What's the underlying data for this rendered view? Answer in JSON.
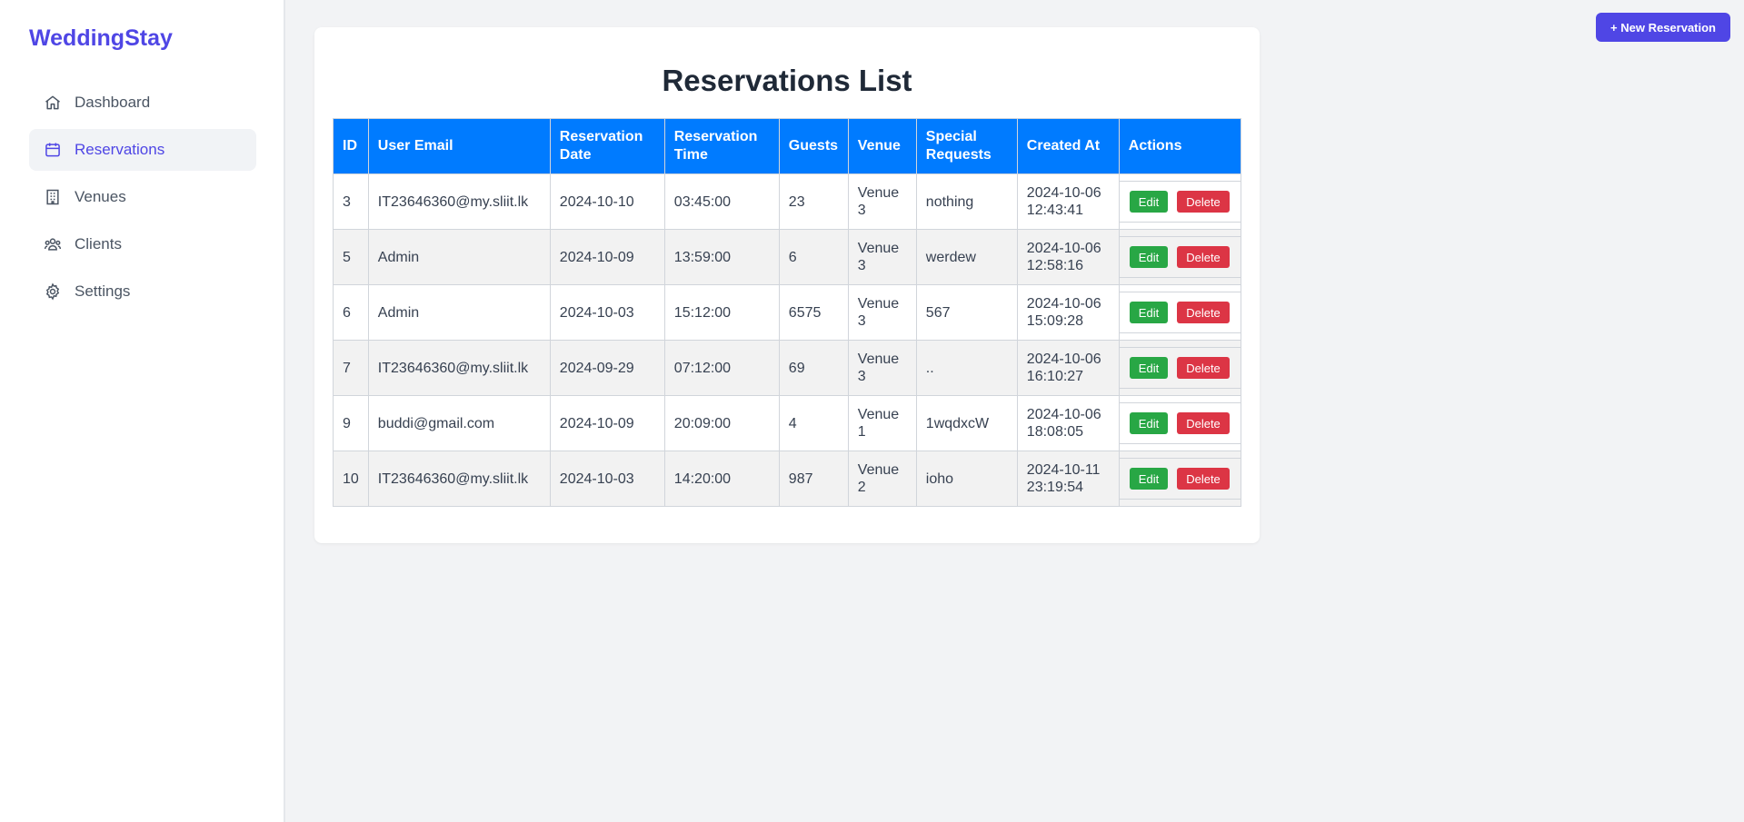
{
  "app": {
    "brand": "WeddingStay"
  },
  "colors": {
    "accent": "#4f46e5",
    "table_header": "#007bff",
    "edit": "#28a745",
    "delete": "#dc3545"
  },
  "sidebar": {
    "items": [
      {
        "label": "Dashboard",
        "icon": "home-icon",
        "active": false
      },
      {
        "label": "Reservations",
        "icon": "calendar-icon",
        "active": true
      },
      {
        "label": "Venues",
        "icon": "building-icon",
        "active": false
      },
      {
        "label": "Clients",
        "icon": "users-icon",
        "active": false
      },
      {
        "label": "Settings",
        "icon": "gear-icon",
        "active": false
      }
    ]
  },
  "header": {
    "new_button": "+ New Reservation"
  },
  "main": {
    "title": "Reservations List",
    "columns": [
      "ID",
      "User Email",
      "Reservation Date",
      "Reservation Time",
      "Guests",
      "Venue",
      "Special Requests",
      "Created At",
      "Actions"
    ],
    "rows": [
      {
        "id": "3",
        "email": "IT23646360@my.sliit.lk",
        "date": "2024-10-10",
        "time": "03:45:00",
        "guests": "23",
        "venue": "Venue 3",
        "requests": "nothing",
        "created": "2024-10-06 12:43:41"
      },
      {
        "id": "5",
        "email": "Admin",
        "date": "2024-10-09",
        "time": "13:59:00",
        "guests": "6",
        "venue": "Venue 3",
        "requests": "werdew",
        "created": "2024-10-06 12:58:16"
      },
      {
        "id": "6",
        "email": "Admin",
        "date": "2024-10-03",
        "time": "15:12:00",
        "guests": "6575",
        "venue": "Venue 3",
        "requests": "567",
        "created": "2024-10-06 15:09:28"
      },
      {
        "id": "7",
        "email": "IT23646360@my.sliit.lk",
        "date": "2024-09-29",
        "time": "07:12:00",
        "guests": "69",
        "venue": "Venue 3",
        "requests": "..",
        "created": "2024-10-06 16:10:27"
      },
      {
        "id": "9",
        "email": "buddi@gmail.com",
        "date": "2024-10-09",
        "time": "20:09:00",
        "guests": "4",
        "venue": "Venue 1",
        "requests": "1wqdxcW",
        "created": "2024-10-06 18:08:05"
      },
      {
        "id": "10",
        "email": "IT23646360@my.sliit.lk",
        "date": "2024-10-03",
        "time": "14:20:00",
        "guests": "987",
        "venue": "Venue 2",
        "requests": "ioho",
        "created": "2024-10-11 23:19:54"
      }
    ],
    "edit_label": "Edit",
    "delete_label": "Delete"
  }
}
